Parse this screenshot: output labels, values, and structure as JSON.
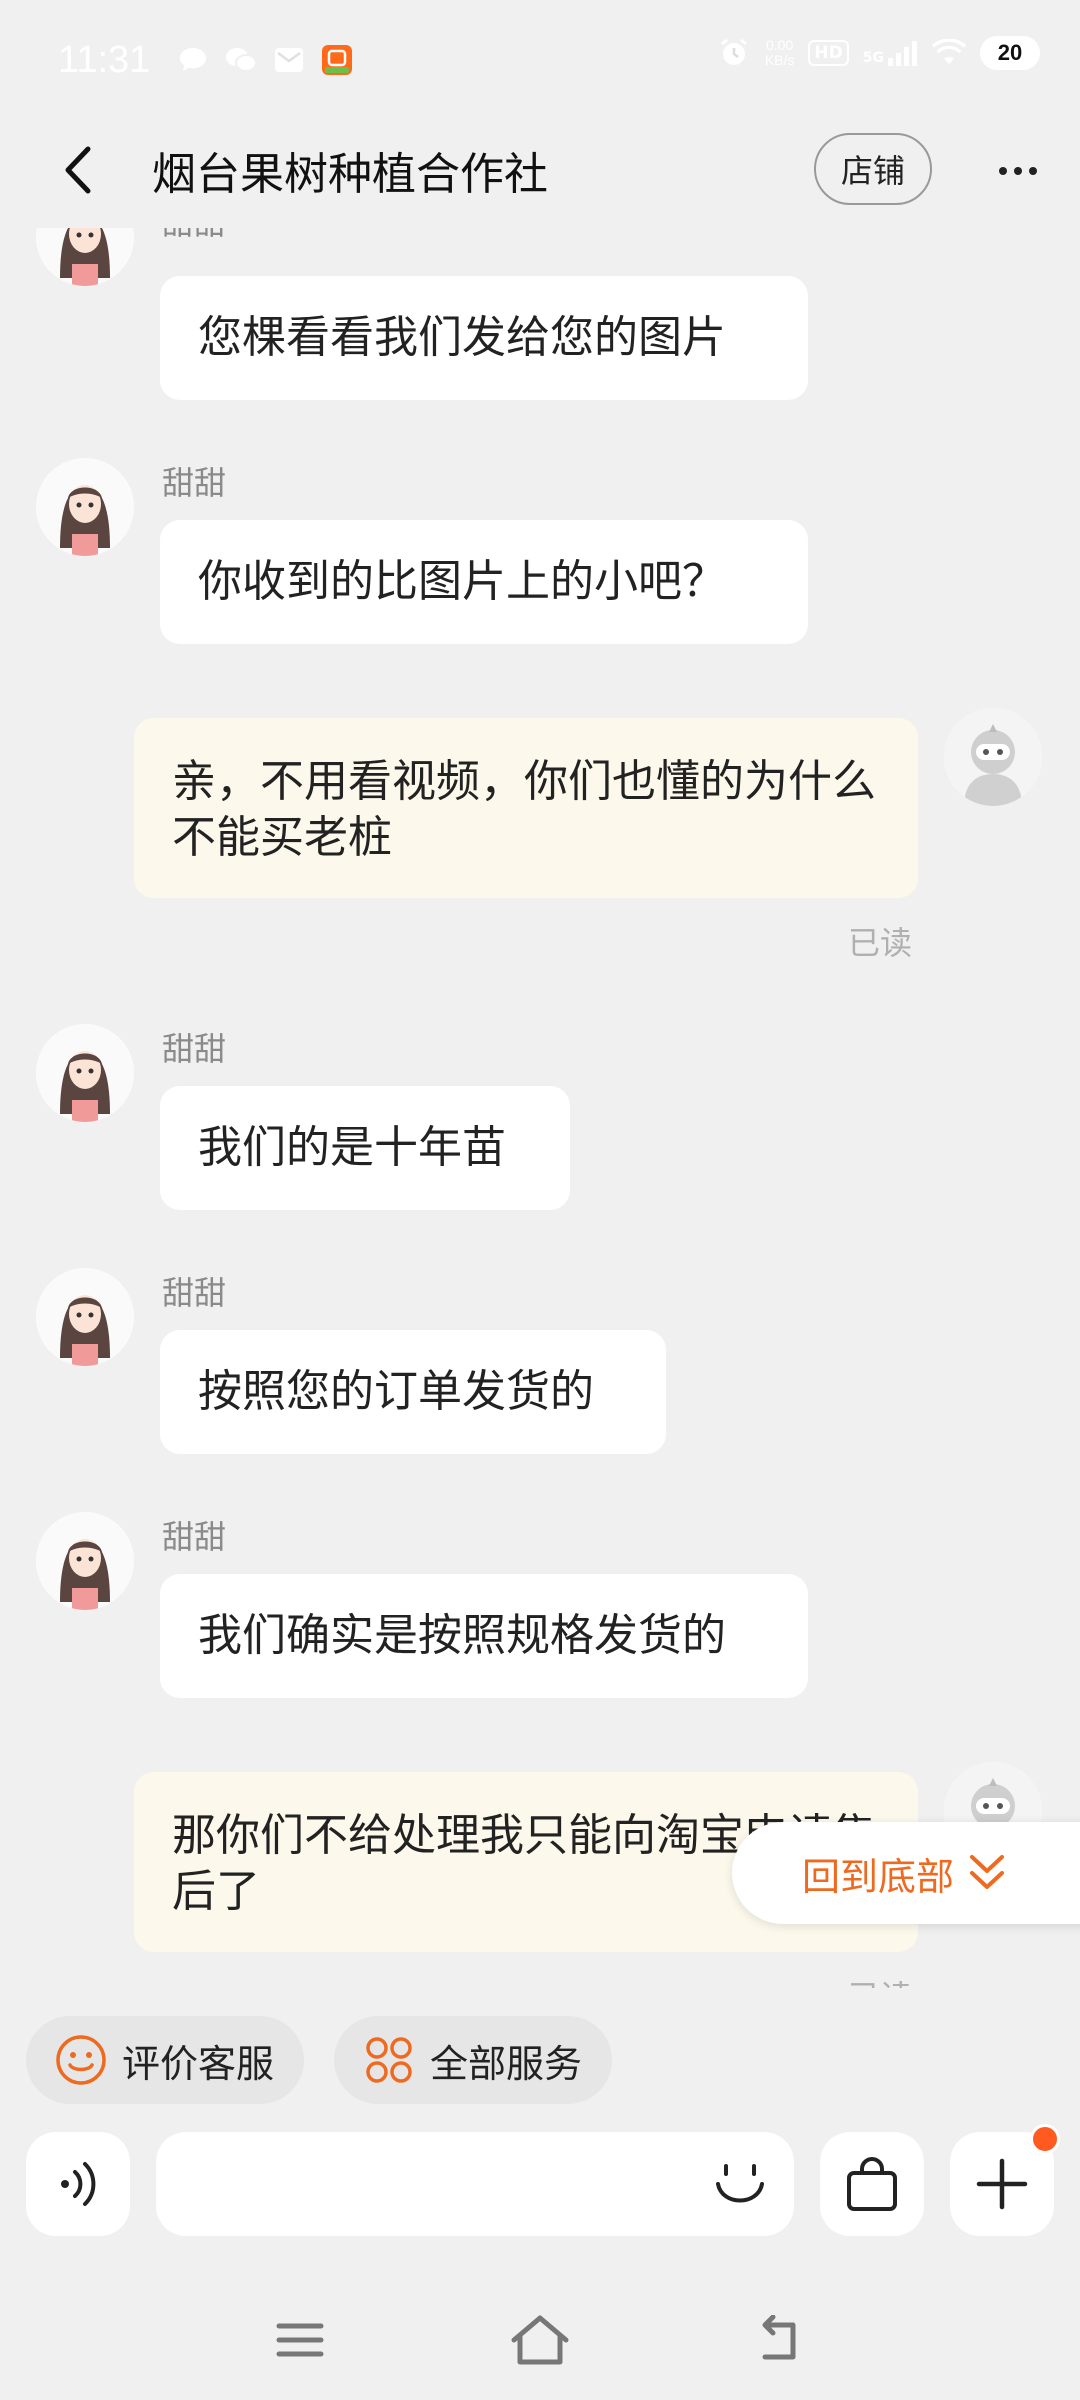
{
  "status_bar": {
    "time": "11:31",
    "net_speed_value": "0.00",
    "net_speed_unit": "KB/s",
    "hd": "HD",
    "network": "5G",
    "battery": "20"
  },
  "header": {
    "title": "烟台果树种植合作社",
    "shop_label": "店铺"
  },
  "messages": [
    {
      "sender": "甜甜",
      "text": "您棵看看我们发给您的图片"
    },
    {
      "sender": "甜甜",
      "text": "你收到的比图片上的小吧？"
    },
    {
      "text": "亲，不用看视频，你们也懂的为什么不能买老桩",
      "status": "已读"
    },
    {
      "sender": "甜甜",
      "text": "我们的是十年苗"
    },
    {
      "sender": "甜甜",
      "text": "按照您的订单发货的"
    },
    {
      "sender": "甜甜",
      "text": "我们确实是按照规格发货的"
    },
    {
      "text": "那你们不给处理我只能向淘宝申请售后了",
      "status": "已读"
    }
  ],
  "back_to_bottom": "回到底部",
  "quick_actions": [
    {
      "label": "评价客服",
      "icon": "smiley-icon"
    },
    {
      "label": "全部服务",
      "icon": "grid-icon"
    }
  ],
  "input": {
    "placeholder": ""
  },
  "colors": {
    "accent": "#ee6a20",
    "my_bubble": "#fcf9ec",
    "background": "#f0f0f0"
  }
}
